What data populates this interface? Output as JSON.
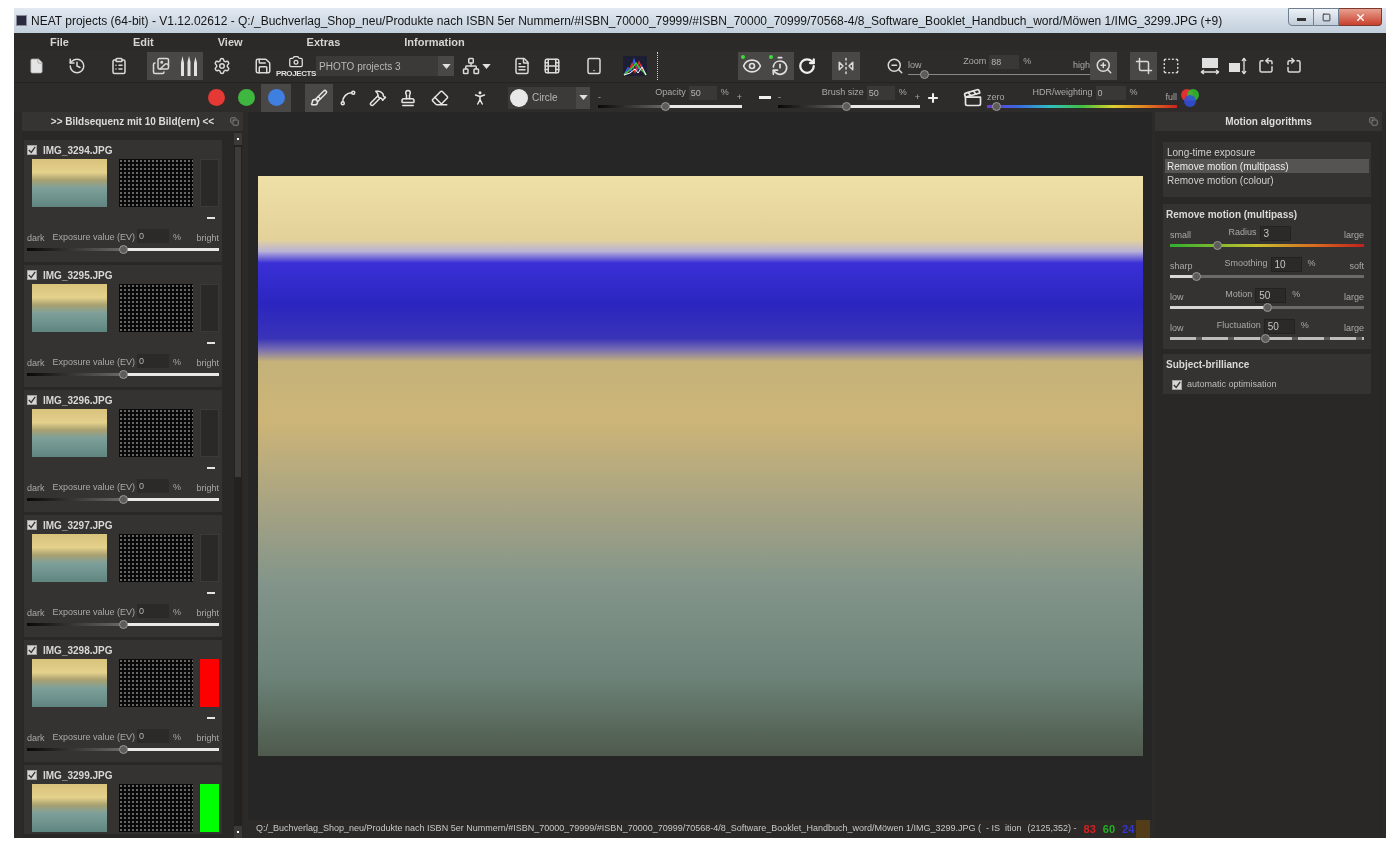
{
  "window": {
    "title": "NEAT projects (64-bit) - V1.12.02612 - Q:/_Buchverlag_Shop_neu/Produkte nach ISBN 5er Nummern/#ISBN_70000_79999/#ISBN_70000_70999/70568-4/8_Software_Booklet_Handbuch_word/Möwen 1/IMG_3299.JPG (+9)"
  },
  "menu": [
    "File",
    "Edit",
    "View",
    "Extras",
    "Information"
  ],
  "toolbar": {
    "file_buttons": [
      {
        "kind": "new",
        "active": false
      },
      {
        "kind": "history",
        "active": false
      },
      {
        "kind": "clipboard",
        "active": false
      },
      {
        "kind": "images",
        "active": true
      },
      {
        "kind": "brushes",
        "active": true
      },
      {
        "kind": "settings",
        "active": false
      },
      {
        "kind": "save",
        "active": false
      },
      {
        "kind": "projects",
        "label": "PROJECTS",
        "active": false
      }
    ],
    "project_select": {
      "value": "PHOTO projects 3"
    },
    "output_buttons": [
      {
        "kind": "network",
        "active": false
      },
      {
        "kind": "export",
        "active": false
      },
      {
        "kind": "film",
        "active": false
      },
      {
        "kind": "device",
        "active": false
      },
      {
        "kind": "histogram",
        "active": false
      }
    ],
    "view_buttons": [
      {
        "kind": "eye",
        "active": true,
        "marked": true
      },
      {
        "kind": "timer",
        "active": true,
        "marked": true
      },
      {
        "kind": "redo",
        "active": false,
        "marked": false
      },
      {
        "kind": "mirror",
        "active": true,
        "marked": false
      },
      {
        "kind": "zoom_out",
        "active": false,
        "marked": false
      }
    ],
    "zoom": {
      "low": "low",
      "label": "Zoom",
      "value": "88",
      "unit": "%",
      "high": "high",
      "level": 0.07
    },
    "frame_buttons": [
      {
        "kind": "zoom_in",
        "active": true
      },
      {
        "kind": "crop",
        "active": true
      },
      {
        "kind": "select",
        "active": false
      },
      {
        "kind": "fit_width",
        "active": false
      },
      {
        "kind": "fit_height",
        "active": false
      },
      {
        "kind": "rotate_left",
        "active": false
      },
      {
        "kind": "rotate_right",
        "active": false
      }
    ]
  },
  "brush_bar": {
    "mask_colors": [
      {
        "color": "#e53935",
        "selected": false
      },
      {
        "color": "#3fb63f",
        "selected": false
      },
      {
        "color": "#3f7fe0",
        "selected": true
      }
    ],
    "tools": [
      {
        "kind": "brush",
        "selected": true
      },
      {
        "kind": "curve",
        "selected": false
      },
      {
        "kind": "hammer",
        "selected": false
      },
      {
        "kind": "stamp",
        "selected": false
      },
      {
        "kind": "eraser",
        "selected": false
      },
      {
        "kind": "figure",
        "selected": false
      }
    ],
    "shape_select": {
      "value": "Circle"
    },
    "opacity": {
      "minus": "-",
      "label": "Opacity",
      "value": "50",
      "unit": "%",
      "plus": "+",
      "level": 0.47
    },
    "brush_size": {
      "minus": "-",
      "label": "Brush size",
      "value": "50",
      "unit": "%",
      "plus": "+",
      "level": 0.48
    },
    "hdr": {
      "low": "zero",
      "label": "HDR/weighting",
      "value": "0",
      "unit": "%",
      "high": "full",
      "level": 0.03
    }
  },
  "sequence_panel": {
    "title": ">> Bildsequenz mit 10 Bild(ern) <<",
    "images": [
      {
        "name": "IMG_3294.JPG",
        "checked": true,
        "exposure": {
          "low": "dark",
          "label": "Exposure value (EV)",
          "value": "0",
          "unit": "%",
          "high": "bright",
          "level": 0.5
        }
      },
      {
        "name": "IMG_3295.JPG",
        "checked": true,
        "exposure": {
          "low": "dark",
          "label": "Exposure value (EV)",
          "value": "0",
          "unit": "%",
          "high": "bright",
          "level": 0.5
        }
      },
      {
        "name": "IMG_3296.JPG",
        "checked": true,
        "exposure": {
          "low": "dark",
          "label": "Exposure value (EV)",
          "value": "0",
          "unit": "%",
          "high": "bright",
          "level": 0.5
        }
      },
      {
        "name": "IMG_3297.JPG",
        "checked": true,
        "exposure": {
          "low": "dark",
          "label": "Exposure value (EV)",
          "value": "0",
          "unit": "%",
          "high": "bright",
          "level": 0.5
        }
      },
      {
        "name": "IMG_3298.JPG",
        "checked": true,
        "color": "#ff0000",
        "exposure": {
          "low": "dark",
          "label": "Exposure value (EV)",
          "value": "0",
          "unit": "%",
          "high": "bright",
          "level": 0.5
        }
      },
      {
        "name": "IMG_3299.JPG",
        "checked": true,
        "color": "#00ff00"
      }
    ]
  },
  "viewer": {
    "status_bar": {
      "path": "Q:/_Buchverlag_Shop_neu/Produkte nach ISBN 5er Nummern/#ISBN_70000_79999/#ISBN_70000_70999/70568-4/8_Software_Booklet_Handbuch_word/Möwen 1/IMG_3299.JPG (",
      "fragments": [
        "- IS",
        "ition"
      ],
      "position": "(2125,352) -",
      "channels": [
        {
          "value": "83",
          "color": "#d42020"
        },
        {
          "value": "60",
          "color": "#22b022"
        },
        {
          "value": "24",
          "color": "#3434d0"
        }
      ],
      "swatch": {
        "color": "#533c18"
      }
    }
  },
  "motion_panel": {
    "title": "Motion algorithms",
    "algorithms": [
      {
        "label": "Long-time exposure",
        "selected": false
      },
      {
        "label": "Remove motion (multipass)",
        "selected": true
      },
      {
        "label": "Remove motion (colour)",
        "selected": false
      }
    ],
    "settings": {
      "title": "Remove motion (multipass)",
      "sliders": [
        {
          "kind": "gradient",
          "low": "small",
          "label": "Radius",
          "value": "3",
          "high": "large",
          "level": 0.23
        },
        {
          "kind": "plain",
          "low": "sharp",
          "label": "Smoothing",
          "value": "10",
          "unit": "%",
          "high": "soft",
          "level": 0.12
        },
        {
          "kind": "plain",
          "low": "low",
          "label": "Motion",
          "value": "50",
          "unit": "%",
          "high": "large",
          "level": 0.5
        },
        {
          "kind": "dashed",
          "low": "low",
          "label": "Fluctuation",
          "value": "50",
          "unit": "%",
          "high": "large",
          "level": 0.49
        }
      ]
    },
    "brilliance": {
      "title": "Subject-brilliance",
      "options": [
        {
          "label": "automatic optimisation",
          "checked": true
        }
      ]
    }
  }
}
